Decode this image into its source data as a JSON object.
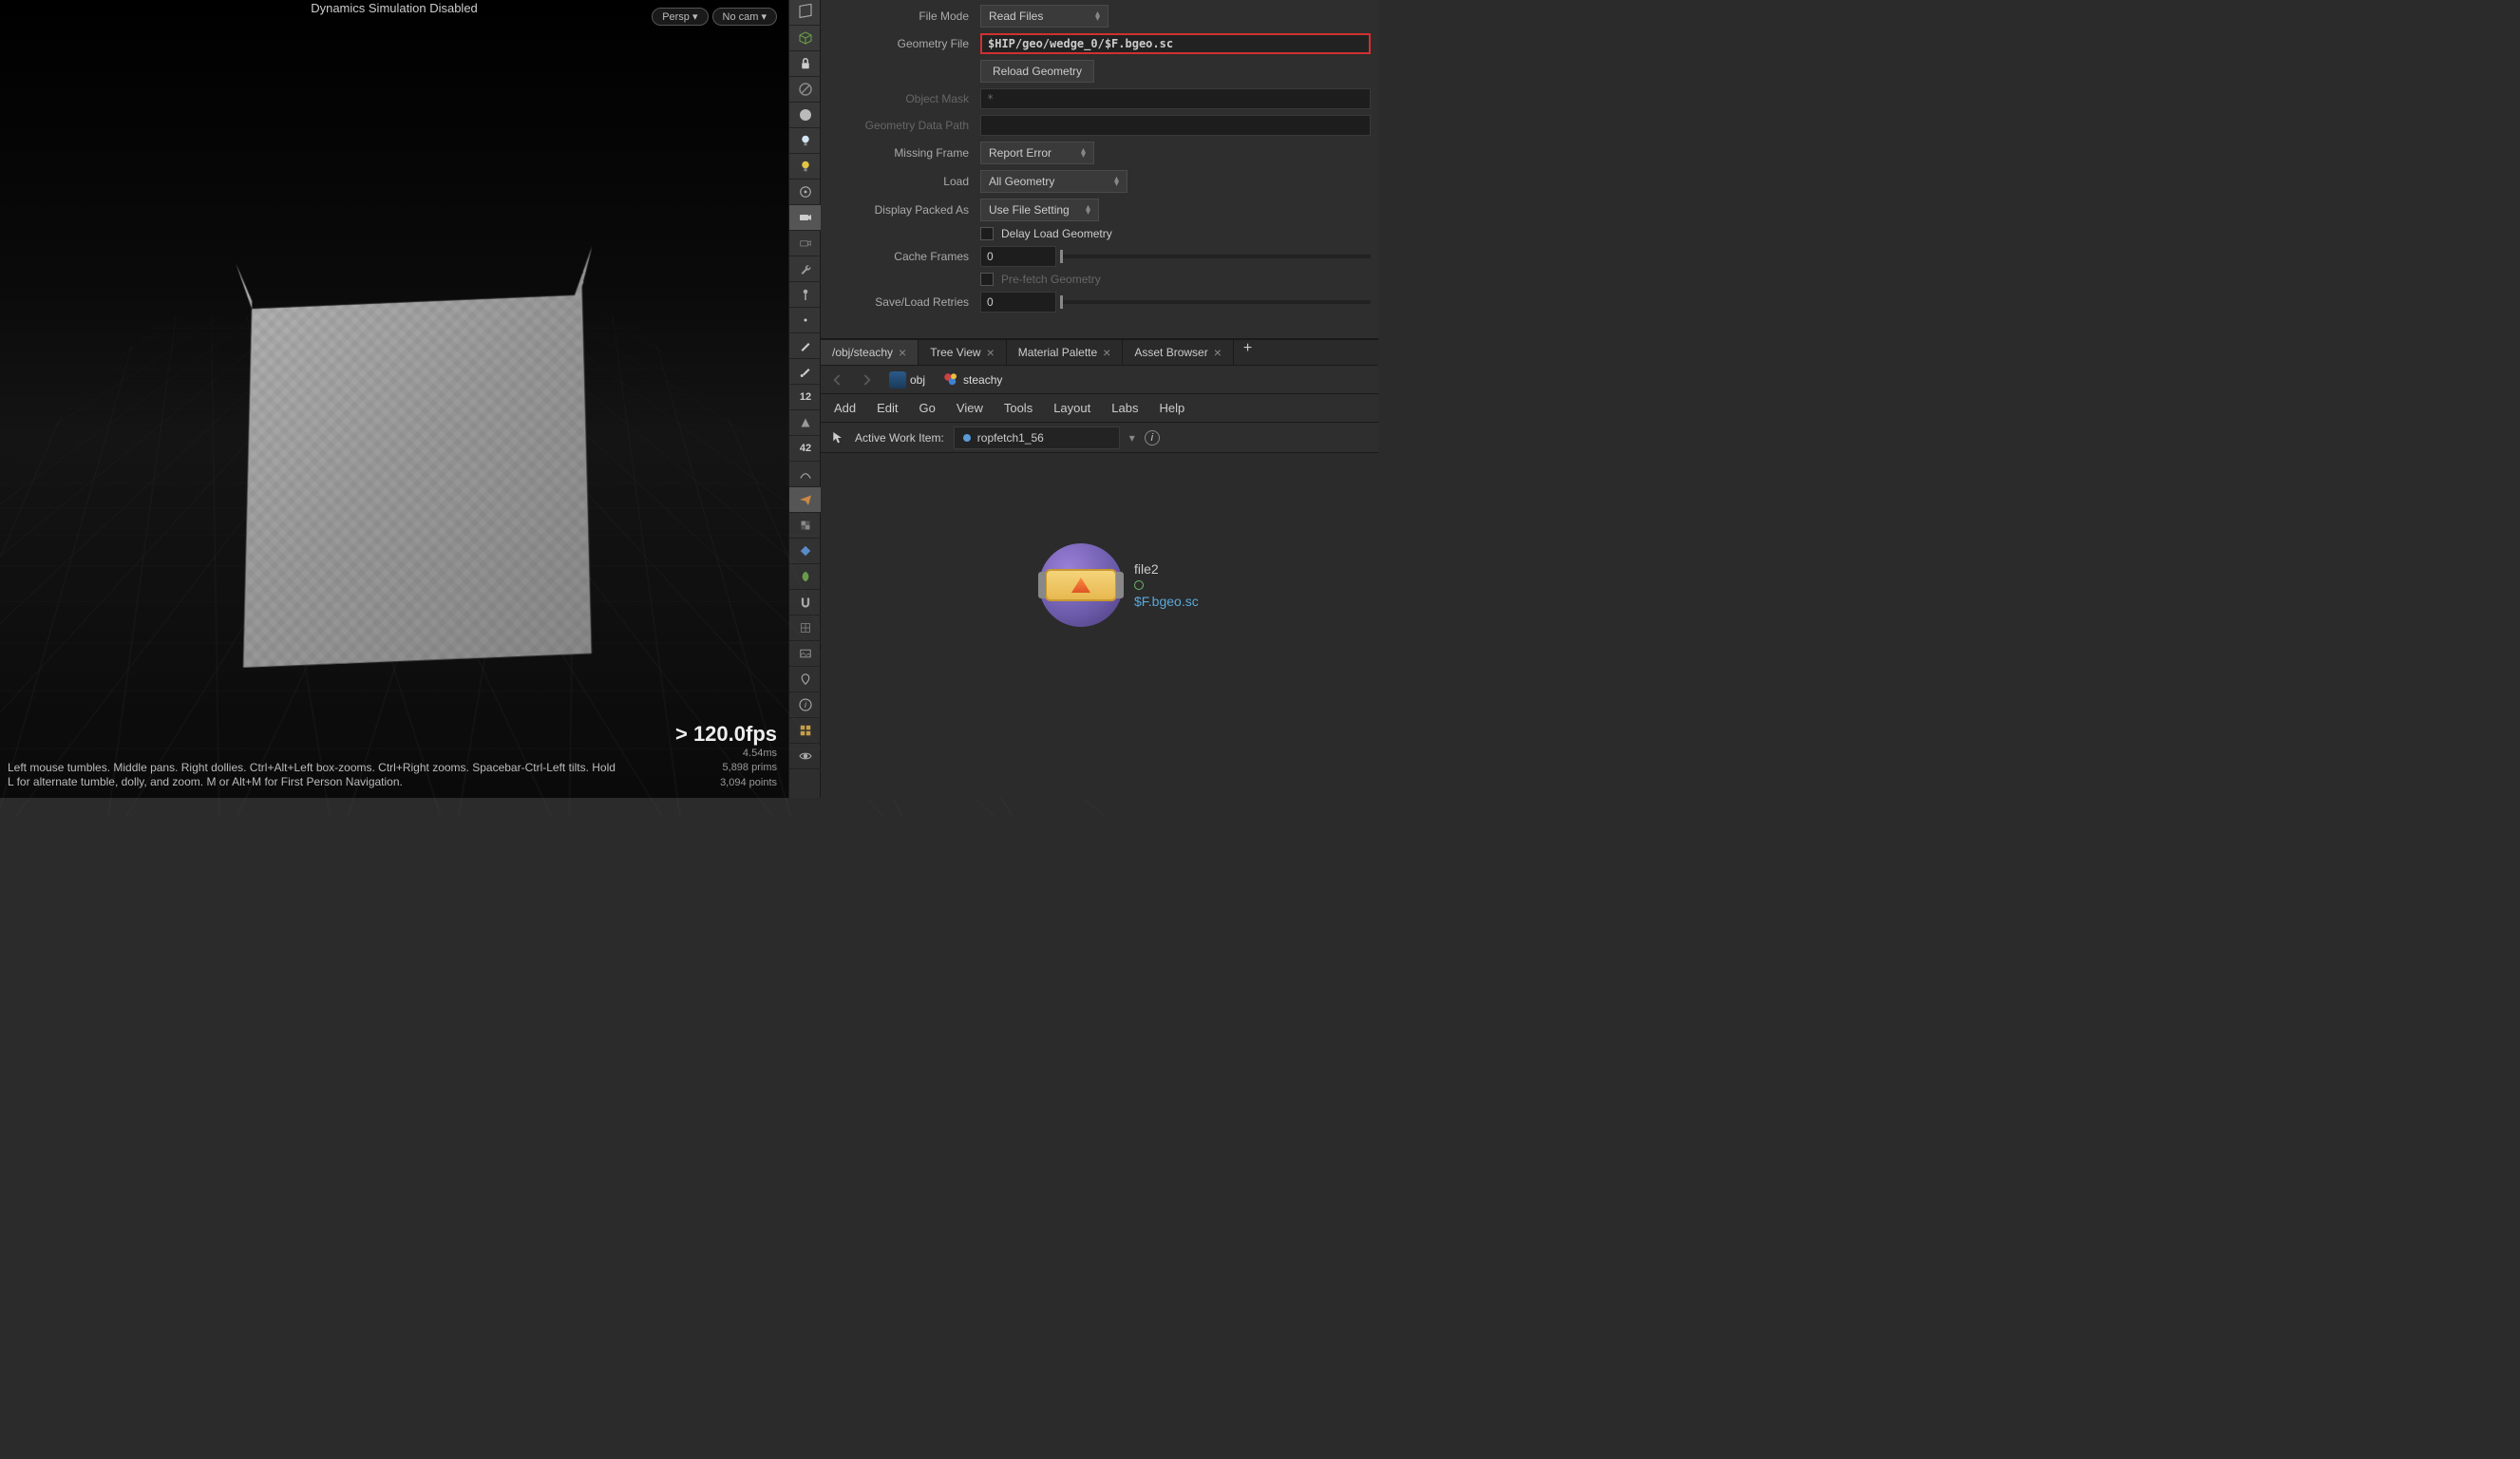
{
  "viewport": {
    "title": "Dynamics Simulation Disabled",
    "persp": "Persp ▾",
    "nocam": "No cam ▾",
    "fps": "> 120.0fps",
    "ms": "4.54ms",
    "prims": "5,898  prims",
    "points": "3,094 points",
    "help": "Left mouse tumbles. Middle pans. Right dollies. Ctrl+Alt+Left box-zooms. Ctrl+Right zooms. Spacebar-Ctrl-Left tilts. Hold L for alternate tumble, dolly, and zoom.     M or Alt+M for First Person Navigation."
  },
  "toolbar_icons": [
    "persp-icon",
    "cube-icon",
    "lock-icon",
    "no-icon",
    "sphere-icon",
    "light-icon",
    "bulb-icon",
    "geo-icon",
    "camera-icon",
    "cam2-icon",
    "wrench-icon",
    "pin-icon",
    "dot-icon",
    "knife-icon",
    "paint-icon",
    "num12-icon",
    "sculpt-icon",
    "num42-icon",
    "curve-icon",
    "airplane-icon",
    "checker-icon",
    "diamond-icon",
    "leaf-icon",
    "magnet-icon",
    "grid2-icon",
    "image-icon",
    "marker-icon",
    "info-icon",
    "layout-icon",
    "eye-icon"
  ],
  "params": {
    "file_mode_label": "File Mode",
    "file_mode_value": "Read Files",
    "geometry_file_label": "Geometry File",
    "geometry_file_value": "$HIP/geo/wedge_0/$F.bgeo.sc",
    "reload_button": "Reload Geometry",
    "object_mask_label": "Object Mask",
    "object_mask_value": "*",
    "geo_data_path_label": "Geometry Data Path",
    "missing_frame_label": "Missing Frame",
    "missing_frame_value": "Report Error",
    "load_label": "Load",
    "load_value": "All Geometry",
    "display_packed_label": "Display Packed As",
    "display_packed_value": "Use File Setting",
    "delay_load_label": "Delay Load Geometry",
    "cache_frames_label": "Cache Frames",
    "cache_frames_value": "0",
    "prefetch_label": "Pre-fetch Geometry",
    "retries_label": "Save/Load Retries",
    "retries_value": "0"
  },
  "tabs": [
    {
      "label": "/obj/steachy",
      "closable": true
    },
    {
      "label": "Tree View",
      "closable": true
    },
    {
      "label": "Material Palette",
      "closable": true
    },
    {
      "label": "Asset Browser",
      "closable": true
    }
  ],
  "path": {
    "obj": "obj",
    "current": "steachy"
  },
  "menu": [
    "Add",
    "Edit",
    "Go",
    "View",
    "Tools",
    "Layout",
    "Labs",
    "Help"
  ],
  "work_item": {
    "label": "Active Work Item:",
    "value": "ropfetch1_56"
  },
  "node": {
    "name": "file2",
    "file": "$F.bgeo.sc"
  }
}
